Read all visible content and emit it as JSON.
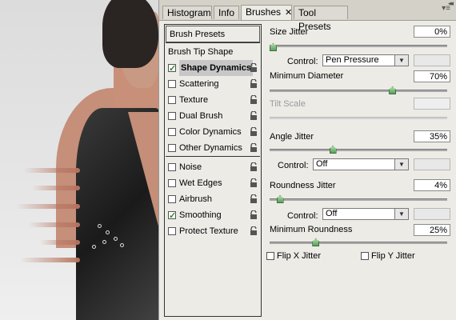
{
  "tabs": [
    {
      "label": "Histogram",
      "active": false
    },
    {
      "label": "Info",
      "active": false
    },
    {
      "label": "Brushes",
      "active": true,
      "close": "✕"
    },
    {
      "label": "Tool Presets",
      "active": false
    }
  ],
  "options": {
    "presets_label": "Brush Presets",
    "tip_shape_label": "Brush Tip Shape",
    "items": [
      {
        "label": "Shape Dynamics",
        "checked": true,
        "selected": true
      },
      {
        "label": "Scattering",
        "checked": false
      },
      {
        "label": "Texture",
        "checked": false
      },
      {
        "label": "Dual Brush",
        "checked": false
      },
      {
        "label": "Color Dynamics",
        "checked": false
      },
      {
        "label": "Other Dynamics",
        "checked": false
      },
      {
        "label": "Noise",
        "checked": false
      },
      {
        "label": "Wet Edges",
        "checked": false
      },
      {
        "label": "Airbrush",
        "checked": false
      },
      {
        "label": "Smoothing",
        "checked": true
      },
      {
        "label": "Protect Texture",
        "checked": false
      }
    ]
  },
  "settings": {
    "size_jitter": {
      "label": "Size Jitter",
      "value": "0%",
      "level": 0
    },
    "control1": {
      "label": "Control:",
      "value": "Pen Pressure"
    },
    "min_diameter": {
      "label": "Minimum Diameter",
      "value": "70%",
      "level": 0.7
    },
    "tilt_scale": {
      "label": "Tilt Scale",
      "value": "",
      "disabled": true
    },
    "angle_jitter": {
      "label": "Angle Jitter",
      "value": "35%",
      "level": 0.35
    },
    "control2": {
      "label": "Control:",
      "value": "Off"
    },
    "roundness_jitter": {
      "label": "Roundness Jitter",
      "value": "4%",
      "level": 0.04
    },
    "control3": {
      "label": "Control:",
      "value": "Off"
    },
    "min_roundness": {
      "label": "Minimum Roundness",
      "value": "25%",
      "level": 0.25
    },
    "flip_x": {
      "label": "Flip X Jitter",
      "checked": false
    },
    "flip_y": {
      "label": "Flip Y Jitter",
      "checked": false
    }
  },
  "colors": {
    "accent_thumb": "#5aa05a",
    "panel_bg": "#ecebe6"
  },
  "icons": {
    "lock": "lock-icon",
    "check": "checkmark",
    "dropdown": "chevron-down-icon"
  }
}
